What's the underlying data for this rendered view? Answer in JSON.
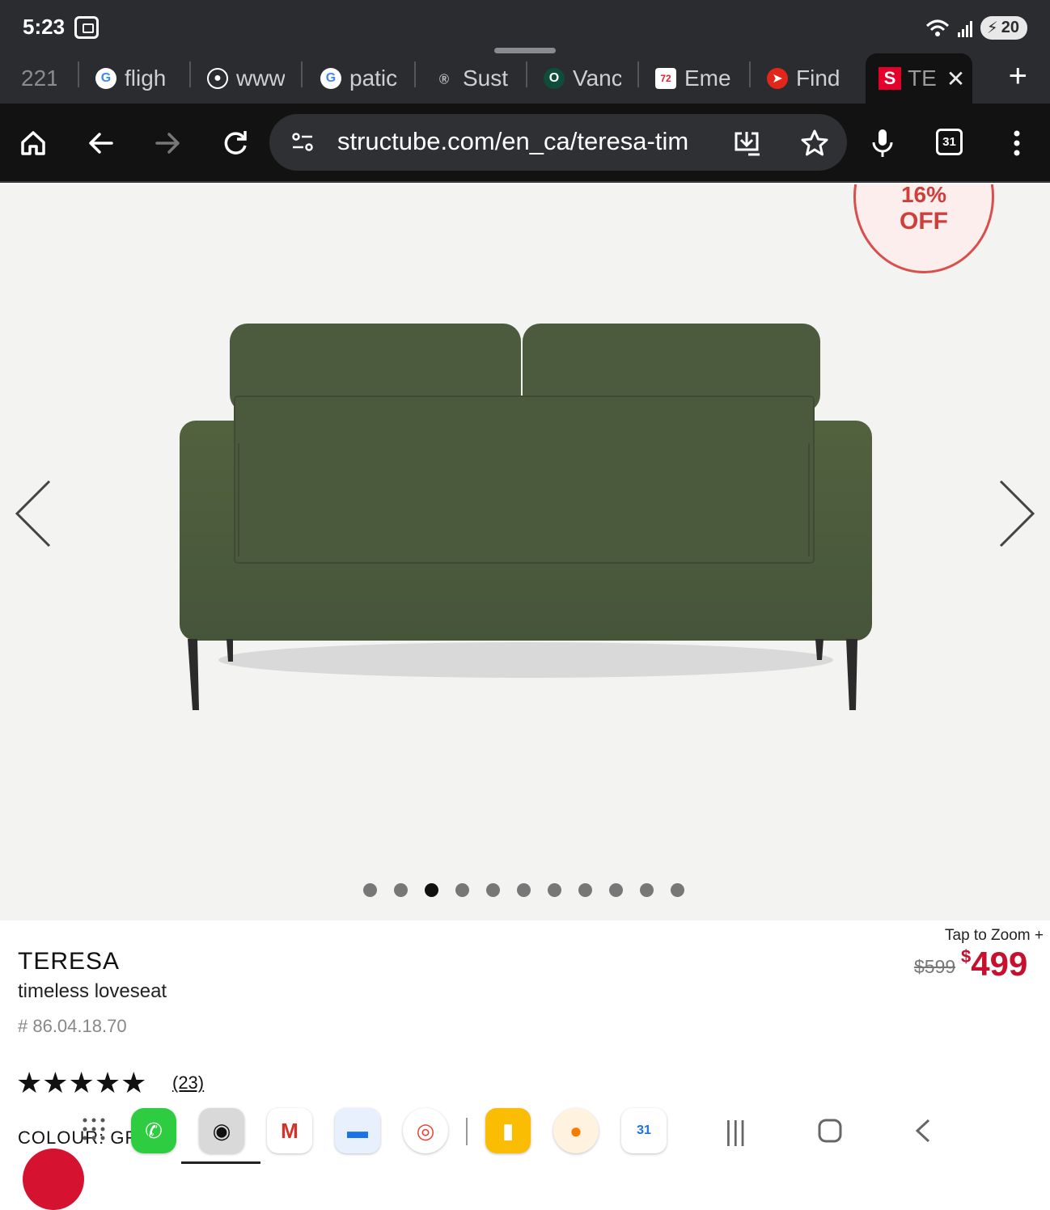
{
  "status": {
    "time": "5:23",
    "battery": "20"
  },
  "tabs": [
    {
      "label": "221"
    },
    {
      "label": "fligh"
    },
    {
      "label": "www"
    },
    {
      "label": "patic"
    },
    {
      "label": "Sust"
    },
    {
      "label": "Vanc"
    },
    {
      "label": "Eme"
    },
    {
      "label": "Find"
    }
  ],
  "active_tab": {
    "label": "TE",
    "favicon": "S"
  },
  "toolbar": {
    "url": "structube.com/en_ca/teresa-tim",
    "tab_count": "31"
  },
  "hero": {
    "badge_percent": "16%",
    "badge_off": "OFF",
    "image_count": 11,
    "active_index": 2
  },
  "product": {
    "name": "TERESA",
    "subtitle": "timeless loveseat",
    "sku": "# 86.04.18.70",
    "rating_stars": 5,
    "rating_text": "★★★★★",
    "reviews": "(23)",
    "tap_to_zoom": "Tap to Zoom  +",
    "old_price": "$599",
    "new_price_symbol": "$",
    "new_price": "499",
    "colour_label": "COLOUR: GR"
  },
  "colors": {
    "accent": "#c8102e",
    "sofa": "#4a5a3c",
    "browser_bg": "#121212"
  },
  "icons": [
    "home-icon",
    "back-icon",
    "forward-icon",
    "reload-icon",
    "site-settings-icon",
    "download-icon",
    "star-icon",
    "mic-icon",
    "menu-icon"
  ],
  "dock_apps": [
    "apps-grid",
    "phone",
    "camera",
    "gmail",
    "messages",
    "chrome",
    "keep",
    "tasks",
    "calendar"
  ],
  "dock_calendar_day": "31"
}
